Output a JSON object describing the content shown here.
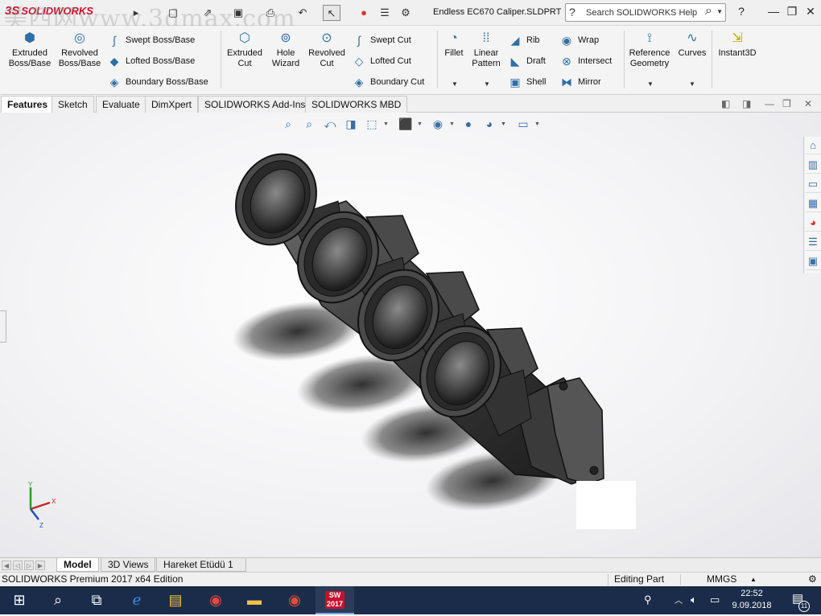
{
  "titlebar": {
    "watermark": "美西网www.3dmax.com",
    "logo_text": "SOLIDWORKS",
    "document_title": "Endless EC670 Caliper.SLDPRT",
    "search_placeholder": "Search SOLIDWORKS Help",
    "help_label": "?"
  },
  "ribbon": {
    "extruded_boss": "Extruded\nBoss/Base",
    "revolved_boss": "Revolved\nBoss/Base",
    "swept_boss": "Swept Boss/Base",
    "lofted_boss": "Lofted Boss/Base",
    "boundary_boss": "Boundary Boss/Base",
    "extruded_cut": "Extruded\nCut",
    "hole_wizard": "Hole\nWizard",
    "revolved_cut": "Revolved\nCut",
    "swept_cut": "Swept Cut",
    "lofted_cut": "Lofted Cut",
    "boundary_cut": "Boundary Cut",
    "fillet": "Fillet",
    "linear_pattern": "Linear\nPattern",
    "rib": "Rib",
    "draft": "Draft",
    "shell": "Shell",
    "wrap": "Wrap",
    "intersect": "Intersect",
    "mirror": "Mirror",
    "reference_geometry": "Reference\nGeometry",
    "curves": "Curves",
    "instant3d": "Instant3D"
  },
  "tabs": [
    "Features",
    "Sketch",
    "Evaluate",
    "DimXpert",
    "SOLIDWORKS Add-Ins",
    "SOLIDWORKS MBD"
  ],
  "model_tabs": [
    "Model",
    "3D Views",
    "Hareket Etüdü 1"
  ],
  "statusbar": {
    "edition": "SOLIDWORKS Premium 2017 x64 Edition",
    "mode": "Editing Part",
    "units": "MMGS"
  },
  "taskbar": {
    "sw_badge": "2017",
    "time": "22:52",
    "date": "9.09.2018",
    "notifications": "11"
  },
  "triad": {
    "x": "X",
    "y": "Y",
    "z": "Z"
  }
}
